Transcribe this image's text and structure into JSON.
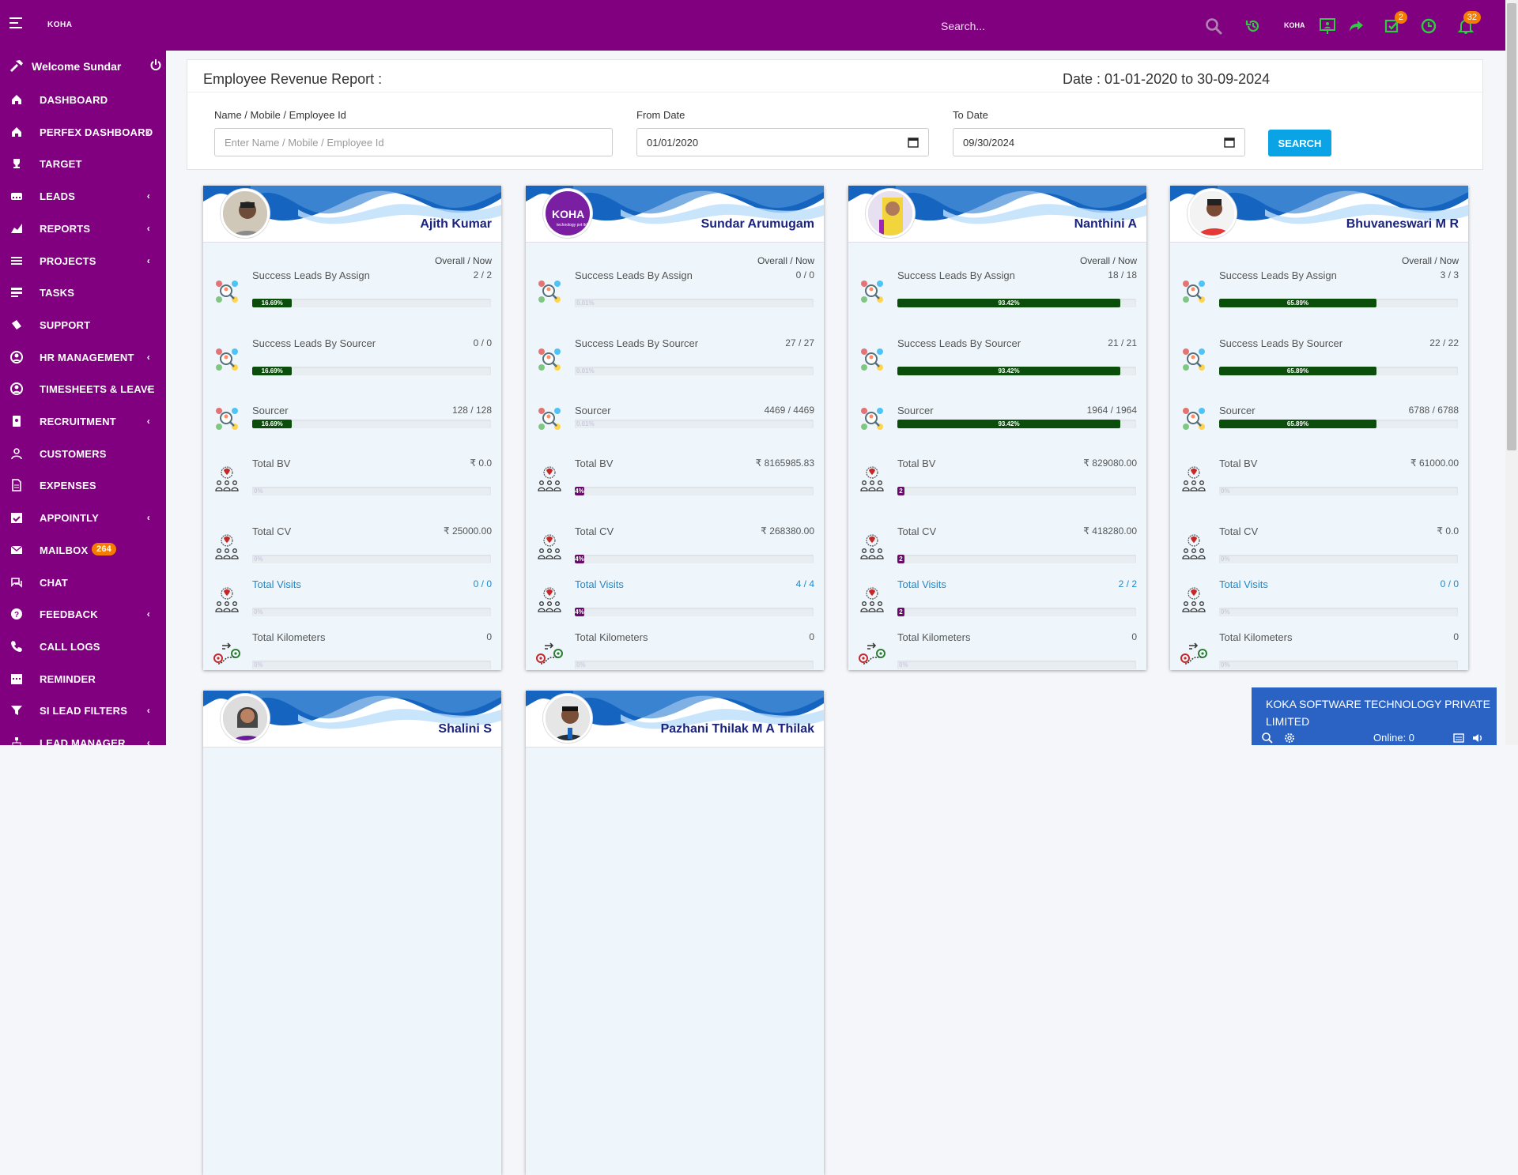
{
  "header": {
    "brand": "KOHA",
    "search_placeholder": "Search...",
    "brand_small": "KOHA",
    "task_badge": "2",
    "notif_badge": "32"
  },
  "sidebar": {
    "welcome": "Welcome Sundar",
    "items": [
      {
        "label": "DASHBOARD",
        "icon": "home-icon",
        "chevron": false
      },
      {
        "label": "PERFEX DASHBOARD",
        "icon": "home-icon",
        "chevron": true
      },
      {
        "label": "TARGET",
        "icon": "trophy-icon",
        "chevron": false
      },
      {
        "label": "LEADS",
        "icon": "tty-icon",
        "chevron": true
      },
      {
        "label": "REPORTS",
        "icon": "area-chart-icon",
        "chevron": true
      },
      {
        "label": "PROJECTS",
        "icon": "bars-icon",
        "chevron": true
      },
      {
        "label": "TASKS",
        "icon": "tasks-icon",
        "chevron": false
      },
      {
        "label": "SUPPORT",
        "icon": "ticket-icon",
        "chevron": false
      },
      {
        "label": "HR MANAGEMENT",
        "icon": "user-circle-icon",
        "chevron": true
      },
      {
        "label": "TIMESHEETS & LEAVE",
        "icon": "user-circle-icon",
        "chevron": true
      },
      {
        "label": "RECRUITMENT",
        "icon": "id-badge-icon",
        "chevron": true
      },
      {
        "label": "CUSTOMERS",
        "icon": "user-icon",
        "chevron": false
      },
      {
        "label": "EXPENSES",
        "icon": "file-icon",
        "chevron": false
      },
      {
        "label": "APPOINTLY",
        "icon": "calendar-check-icon",
        "chevron": true
      },
      {
        "label": "MAILBOX",
        "icon": "envelope-icon",
        "chevron": false,
        "badge": "264"
      },
      {
        "label": "CHAT",
        "icon": "comments-icon",
        "chevron": false
      },
      {
        "label": "FEEDBACK",
        "icon": "question-circle-icon",
        "chevron": true
      },
      {
        "label": "CALL LOGS",
        "icon": "phone-icon",
        "chevron": false
      },
      {
        "label": "REMINDER",
        "icon": "calendar-icon",
        "chevron": false
      },
      {
        "label": "SI LEAD FILTERS",
        "icon": "filter-icon",
        "chevron": true
      },
      {
        "label": "LEAD MANAGER",
        "icon": "sitemap-icon",
        "chevron": true
      }
    ]
  },
  "report": {
    "title": "Employee Revenue Report :",
    "date_range": "Date : 01-01-2020 to 30-09-2024",
    "filter_label": "Name / Mobile / Employee Id",
    "filter_placeholder": "Enter Name / Mobile / Employee Id",
    "from_label": "From Date",
    "from_value": "01/01/2020",
    "to_label": "To Date",
    "to_value": "09/30/2024",
    "search_label": "SEARCH"
  },
  "overall_label": "Overall / Now",
  "metric_labels": [
    "Success Leads By Assign",
    "Success Leads By Sourcer",
    "Sourcer",
    "Total BV",
    "Total CV",
    "Total Visits",
    "Total Kilometers"
  ],
  "employees": [
    {
      "name": "Ajith Kumar",
      "avatar": "person",
      "metrics": [
        {
          "value": "2 / 2",
          "pct": 16.69,
          "label": "16.69%",
          "color": "green"
        },
        {
          "value": "0 / 0",
          "pct": 16.69,
          "label": "16.69%",
          "color": "green"
        },
        {
          "value": "128 / 128",
          "pct": 16.69,
          "label": "16.69%",
          "color": "green"
        },
        {
          "value": "₹ 0.0",
          "pct": 0,
          "label": "0%",
          "color": "purple"
        },
        {
          "value": "₹ 25000.00",
          "pct": 0,
          "label": "0%",
          "color": "purple"
        },
        {
          "value": "0 / 0",
          "pct": 0,
          "label": "0%",
          "color": "purple"
        },
        {
          "value": "0",
          "pct": 0,
          "label": "0%",
          "color": "purple"
        }
      ]
    },
    {
      "name": "Sundar Arumugam",
      "avatar": "koha-logo",
      "metrics": [
        {
          "value": "0 / 0",
          "pct": 0,
          "label": "0.01%",
          "color": "green"
        },
        {
          "value": "27 / 27",
          "pct": 0,
          "label": "0.01%",
          "color": "green"
        },
        {
          "value": "4469 / 4469",
          "pct": 0,
          "label": "0.01%",
          "color": "green"
        },
        {
          "value": "₹ 8165985.83",
          "pct": 4,
          "label": "4%",
          "color": "purple"
        },
        {
          "value": "₹ 268380.00",
          "pct": 4,
          "label": "4%",
          "color": "purple"
        },
        {
          "value": "4 / 4",
          "pct": 4,
          "label": "4%",
          "color": "purple"
        },
        {
          "value": "0",
          "pct": 0,
          "label": "0%",
          "color": "purple"
        }
      ]
    },
    {
      "name": "Nanthini A",
      "avatar": "person-yellow",
      "metrics": [
        {
          "value": "18 / 18",
          "pct": 93.42,
          "label": "93.42%",
          "color": "green"
        },
        {
          "value": "21 / 21",
          "pct": 93.42,
          "label": "93.42%",
          "color": "green"
        },
        {
          "value": "1964 / 1964",
          "pct": 93.42,
          "label": "93.42%",
          "color": "green"
        },
        {
          "value": "₹ 829080.00",
          "pct": 2,
          "label": "2",
          "color": "purple"
        },
        {
          "value": "₹ 418280.00",
          "pct": 2,
          "label": "2",
          "color": "purple"
        },
        {
          "value": "2 / 2",
          "pct": 2,
          "label": "2",
          "color": "purple"
        },
        {
          "value": "0",
          "pct": 0,
          "label": "0%",
          "color": "purple"
        }
      ]
    },
    {
      "name": "Bhuvaneswari M R",
      "avatar": "person-red",
      "metrics": [
        {
          "value": "3 / 3",
          "pct": 65.89,
          "label": "65.89%",
          "color": "green"
        },
        {
          "value": "22 / 22",
          "pct": 65.89,
          "label": "65.89%",
          "color": "green"
        },
        {
          "value": "6788 / 6788",
          "pct": 65.89,
          "label": "65.89%",
          "color": "green"
        },
        {
          "value": "₹ 61000.00",
          "pct": 0,
          "label": "0%",
          "color": "purple"
        },
        {
          "value": "₹ 0.0",
          "pct": 0,
          "label": "0%",
          "color": "purple"
        },
        {
          "value": "0 / 0",
          "pct": 0,
          "label": "0%",
          "color": "purple"
        },
        {
          "value": "0",
          "pct": 0,
          "label": "0%",
          "color": "purple"
        }
      ]
    },
    {
      "name": "Shalini S",
      "avatar": "person-f",
      "metrics": []
    },
    {
      "name": "Pazhani Thilak M A Thilak",
      "avatar": "person-m",
      "metrics": []
    }
  ],
  "chat": {
    "title": "KOKA SOFTWARE TECHNOLOGY PRIVATE LIMITED",
    "online": "Online: 0"
  }
}
